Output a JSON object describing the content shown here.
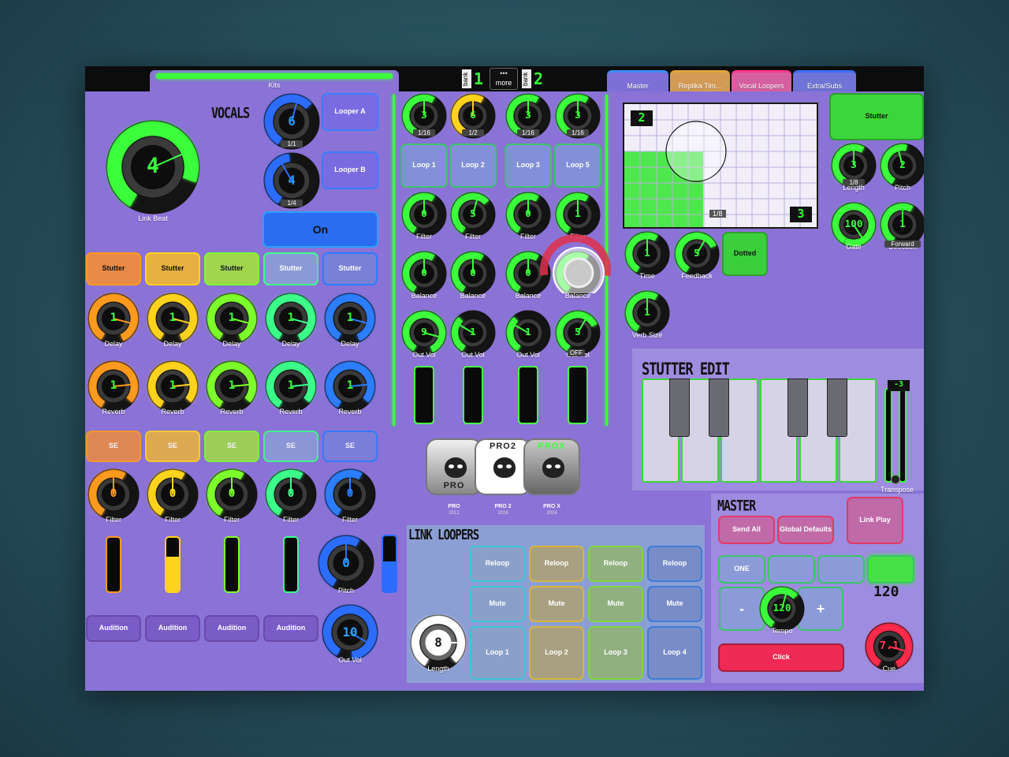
{
  "header": {
    "kits_tab": "Kits",
    "bank_label": "bank",
    "bank_left_num": "1",
    "more_label": "more",
    "bank_right_num": "2",
    "tabs": [
      "Master",
      "Replika Tim...",
      "Vocal Loopers",
      "Extra/Subs"
    ]
  },
  "vocals": {
    "title": "VOCALS",
    "link_beat_value": "4",
    "link_beat_label": "Link Beat",
    "knob_a_value": "6",
    "knob_a_div": "1/1",
    "knob_b_value": "4",
    "knob_b_div": "1/4",
    "looper_a": "Looper A",
    "looper_b": "Looper B",
    "on_button": "On"
  },
  "channels": {
    "stutter_labels": [
      "Stutter",
      "Stutter",
      "Stutter",
      "Stutter",
      "Stutter"
    ],
    "delay_labels": [
      "Delay",
      "Delay",
      "Delay",
      "Delay",
      "Delay"
    ],
    "delay_values": [
      "1",
      "1",
      "1",
      "1",
      "1"
    ],
    "reverb_labels": [
      "Reverb",
      "Reverb",
      "Reverb",
      "Reverb",
      "Reverb"
    ],
    "reverb_values": [
      "1",
      "1",
      "1",
      "1",
      "1"
    ],
    "se_labels": [
      "SE",
      "SE",
      "SE",
      "SE",
      "SE"
    ],
    "filter_labels": [
      "Filter",
      "Filter",
      "Filter",
      "Filter",
      "Filter"
    ],
    "filter_values": [
      "0",
      "0",
      "0",
      "0",
      "0"
    ],
    "meter_levels": [
      0.0,
      0.65,
      0.0,
      0.0
    ],
    "audition_labels": [
      "Audition",
      "Audition",
      "Audition",
      "Audition"
    ],
    "pitch_label": "Pitch",
    "pitch_value": "0",
    "pitch_meter_level": 0.55,
    "outvol_label": "Out Vol",
    "outvol_value": "10",
    "colors": [
      "#ff9a1e",
      "#ffd21e",
      "#7dff2c",
      "#3cff8a",
      "#2c7dff"
    ]
  },
  "loops": {
    "top_values": [
      "3",
      "6",
      "3",
      "3"
    ],
    "top_divs": [
      "1/16",
      "1/2",
      "1/16",
      "1/16"
    ],
    "loop_buttons": [
      "Loop 1",
      "Loop 2",
      "Loop 3",
      "Loop 5"
    ],
    "filter_labels": [
      "Filter",
      "Filter",
      "Filter",
      "Filter"
    ],
    "filter_values": [
      "0",
      "5",
      "0",
      "1"
    ],
    "balance_labels": [
      "Balance",
      "Balance",
      "Balance",
      "Balance"
    ],
    "balance_values": [
      "0",
      "0",
      "0",
      "0"
    ],
    "outvol_labels": [
      "Out Vol",
      "Out Vol",
      "Out Vol",
      "Out Vol"
    ],
    "outvol_values": [
      "9",
      "1",
      "1",
      "5"
    ],
    "off_label": "OFF"
  },
  "apps": {
    "names": [
      "PRO",
      "PRO 2",
      "PRO X"
    ],
    "years": [
      "2012",
      "2016",
      "2024"
    ],
    "icon_texts": [
      "PRO",
      "PRO2",
      "PROX"
    ]
  },
  "link_loopers": {
    "title": "LINK LOOPERS",
    "length_value": "8",
    "length_label": "Length",
    "reloop": [
      "Reloop",
      "Reloop",
      "Reloop",
      "Reloop"
    ],
    "mute": [
      "Mute",
      "Mute",
      "Mute",
      "Mute"
    ],
    "loops": [
      "Loop 1",
      "Loop 2",
      "Loop 3",
      "Loop 4"
    ]
  },
  "xy_pad": {
    "top_value": "2",
    "bottom_value": "3",
    "div_label": "1/8"
  },
  "effects": {
    "time_label": "Time",
    "time_value": "1",
    "feedback_label": "Feedback",
    "feedback_value": "5",
    "dotted_label": "Dotted",
    "verb_label": "Verb Size",
    "verb_value": "1"
  },
  "stutter_panel": {
    "stutter_button": "Stutter",
    "length_label": "Length",
    "length_value": "3",
    "length_div": "1/8",
    "pitch_label": "Pitch",
    "pitch_value": "2",
    "gate_label": "Gate",
    "gate_value": "100",
    "direction_label": "Direction",
    "direction_mode": "Forward",
    "direction_value": "1"
  },
  "stutter_edit": {
    "title": "STUTTER EDIT",
    "transpose_value": "-3",
    "transpose_label": "Transpose"
  },
  "master": {
    "title": "MASTER",
    "send_all": "Send All",
    "global_defaults": "Global Defaults",
    "link_play": "Link Play",
    "one_label": "ONE",
    "minus": "-",
    "plus": "+",
    "tempo_value": "120",
    "tempo_display": "120",
    "tempo_label": "Tempo",
    "click": "Click",
    "cue_value": "7.1",
    "cue_label": "Cue"
  }
}
